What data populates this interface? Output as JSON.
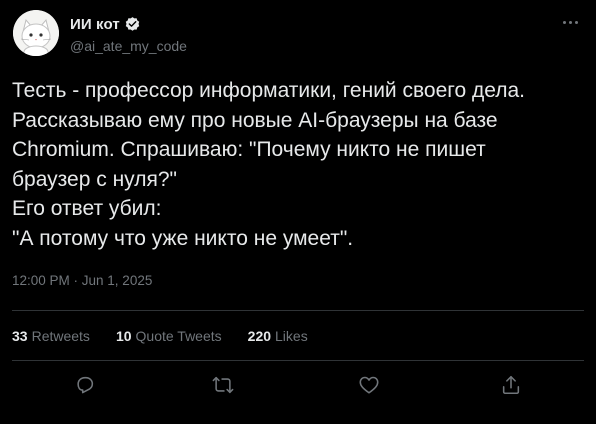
{
  "author": {
    "name": "ИИ кот",
    "handle": "@ai_ate_my_code",
    "verified_color": "#e7e9ea"
  },
  "tweet": {
    "lines": [
      "Тесть - профессор информатики, гений своего дела.",
      "Рассказываю ему про новые AI-браузеры на базе",
      "Chromium. Спрашиваю: \"Почему никто не пишет",
      "браузер с нуля?\"",
      "Его ответ убил:",
      "\"А потому что уже никто не умеет\"."
    ],
    "timestamp": "12:00 PM · Jun 1, 2025"
  },
  "stats": {
    "retweets_count": "33",
    "retweets_label": "Retweets",
    "quotes_count": "10",
    "quotes_label": "Quote Tweets",
    "likes_count": "220",
    "likes_label": "Likes"
  },
  "actions": {
    "reply": "reply-icon",
    "retweet": "retweet-icon",
    "like": "heart-icon",
    "share": "share-icon"
  },
  "colors": {
    "background": "#000000",
    "text": "#e7e9ea",
    "secondary": "#71767b",
    "divider": "#2f3336"
  }
}
